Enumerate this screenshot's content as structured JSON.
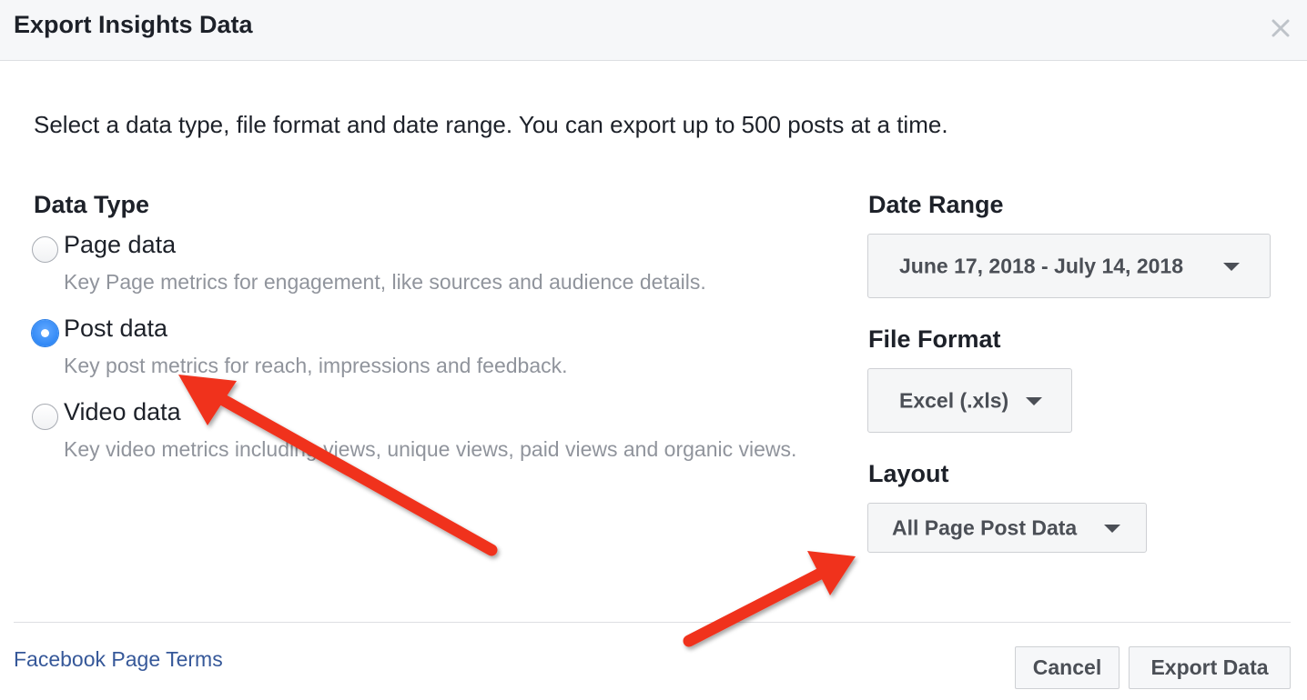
{
  "dialog": {
    "title": "Export Insights Data",
    "close_icon": "close-icon"
  },
  "intro": "Select a data type, file format and date range. You can export up to 500 posts at a time.",
  "data_type": {
    "heading": "Data Type",
    "options": [
      {
        "label": "Page data",
        "description": "Key Page metrics for engagement, like sources and audience details.",
        "checked": false
      },
      {
        "label": "Post data",
        "description": "Key post metrics for reach, impressions and feedback.",
        "checked": true
      },
      {
        "label": "Video data",
        "description": "Key video metrics including views, unique views, paid views and organic views.",
        "checked": false
      }
    ]
  },
  "date_range": {
    "heading": "Date Range",
    "value": "June 17, 2018 - July 14, 2018"
  },
  "file_format": {
    "heading": "File Format",
    "value": "Excel (.xls)"
  },
  "layout": {
    "heading": "Layout",
    "value": "All Page Post Data"
  },
  "footer": {
    "terms_link": "Facebook Page Terms",
    "cancel_label": "Cancel",
    "export_label": "Export Data"
  },
  "colors": {
    "link": "#365899",
    "radio_selected": "#1d7cf2",
    "annotation_arrow": "#f0321e"
  }
}
